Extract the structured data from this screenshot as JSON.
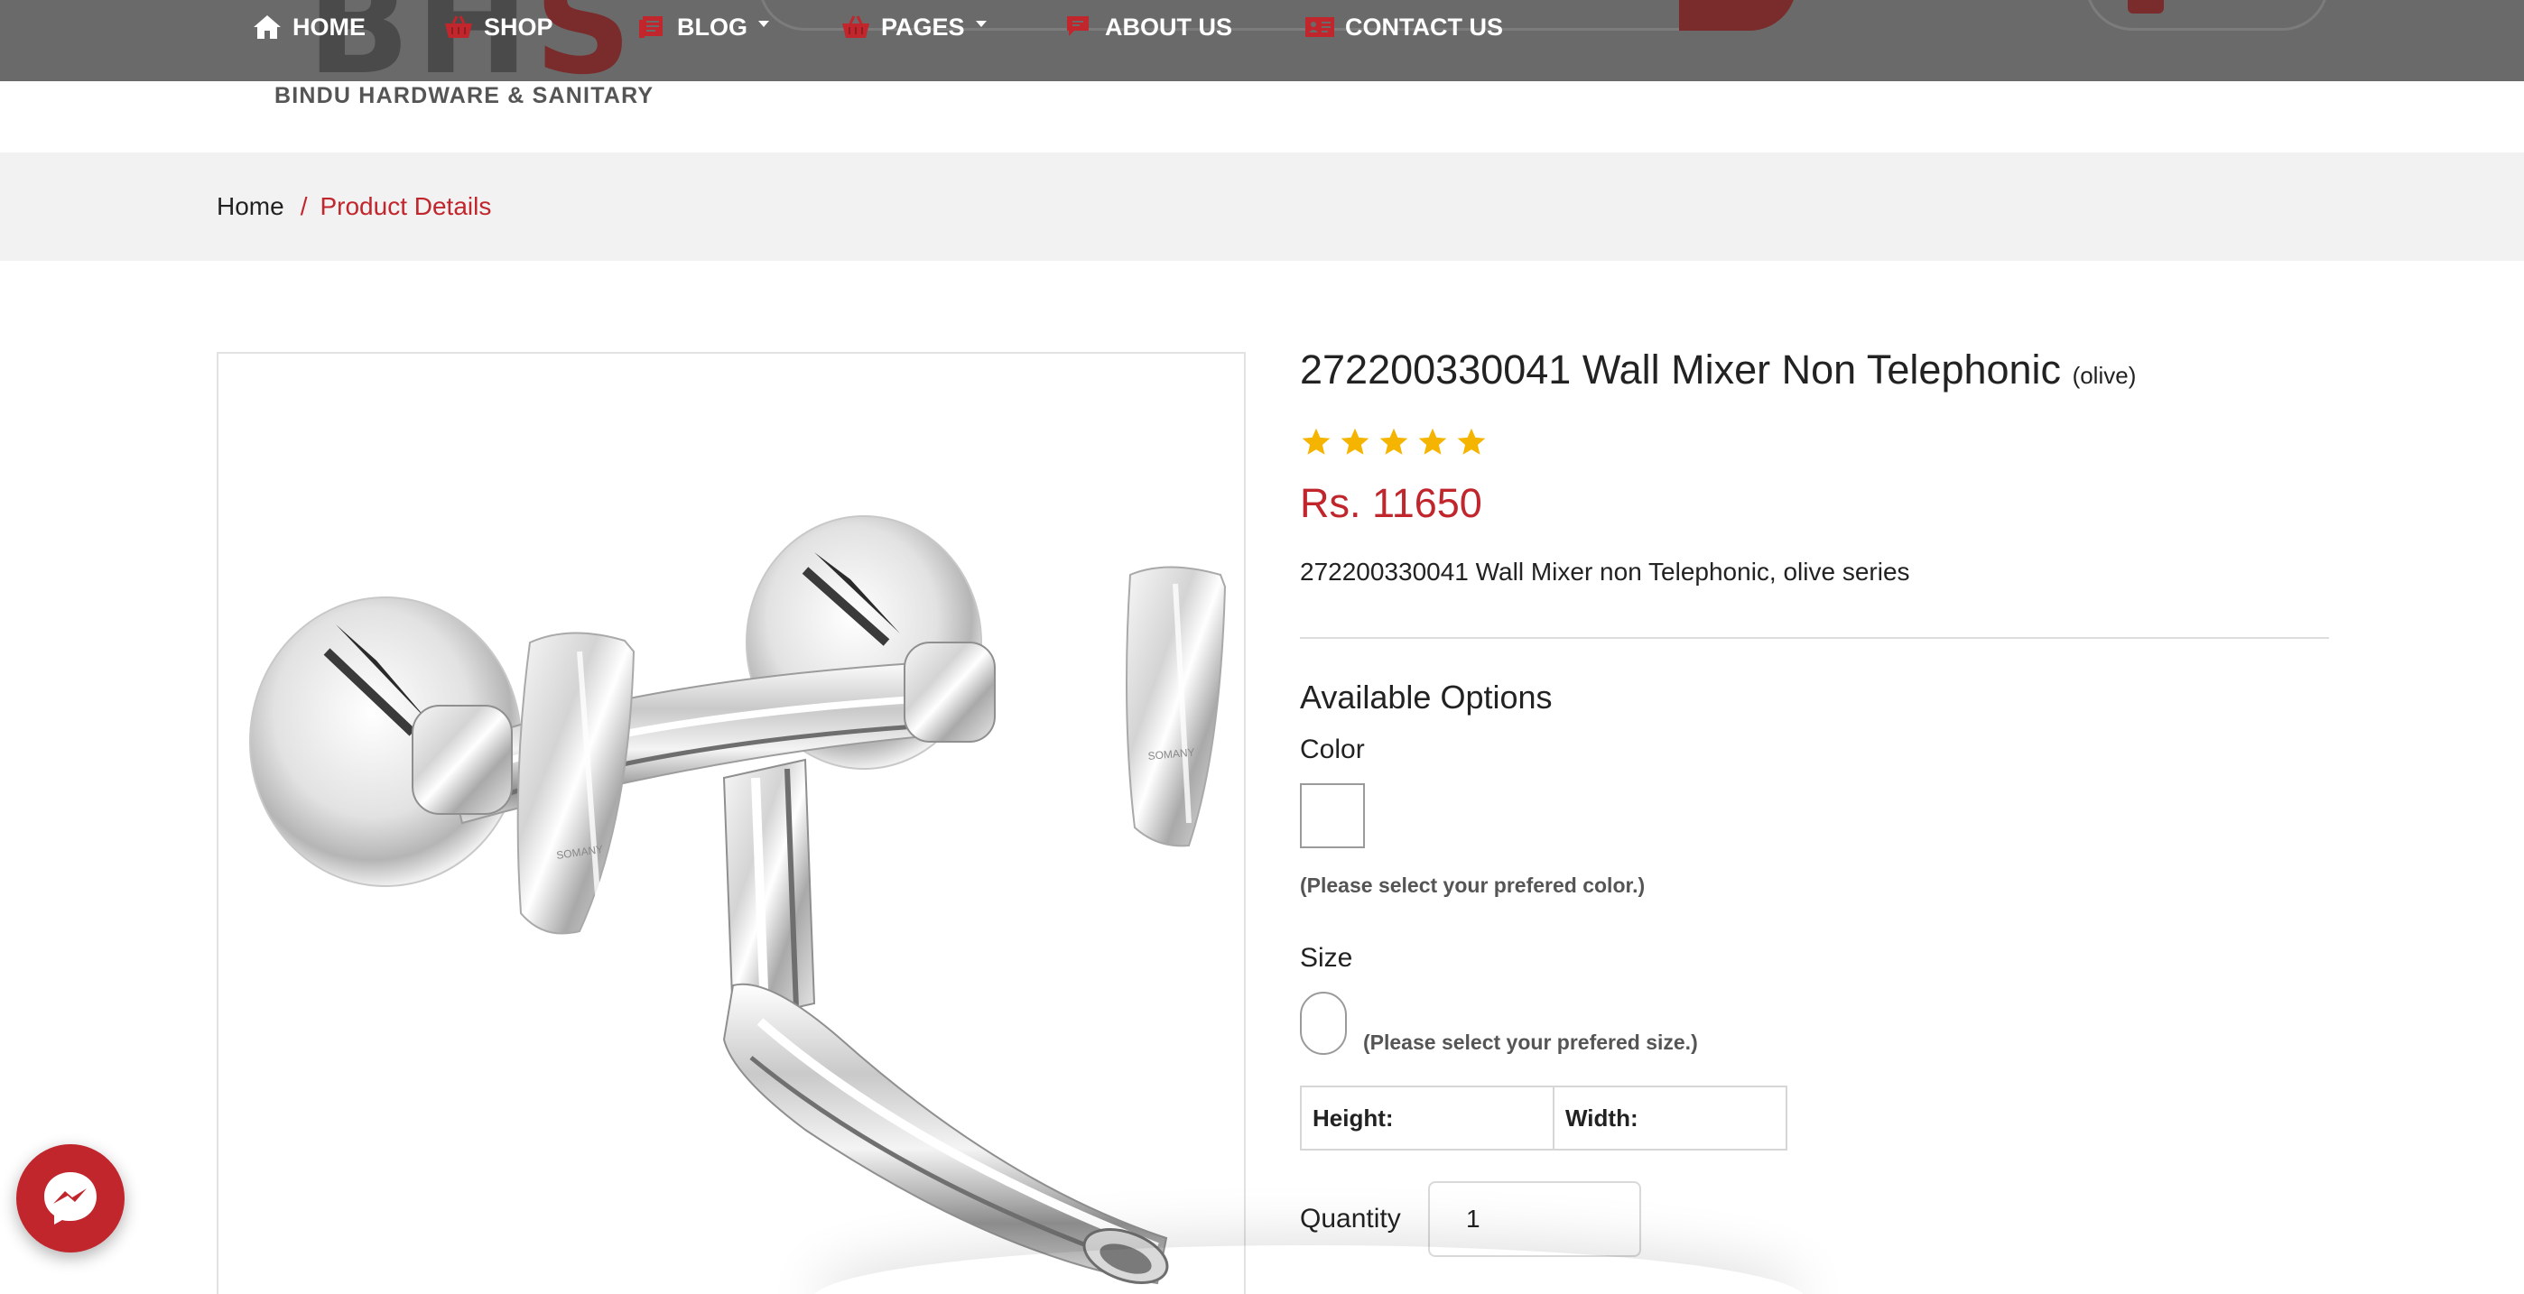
{
  "nav": {
    "items": [
      {
        "label": "HOME",
        "icon": "home-icon",
        "dropdown": false
      },
      {
        "label": "SHOP",
        "icon": "basket-icon",
        "dropdown": false
      },
      {
        "label": "BLOG",
        "icon": "blog-icon",
        "dropdown": true
      },
      {
        "label": "PAGES",
        "icon": "basket-icon",
        "dropdown": true
      },
      {
        "label": "ABOUT US",
        "icon": "chat-icon",
        "dropdown": false
      },
      {
        "label": "CONTACT US",
        "icon": "contact-card-icon",
        "dropdown": false
      }
    ]
  },
  "brand": {
    "logo_text": "BHS",
    "subtitle": "BINDU HARDWARE & SANITARY"
  },
  "breadcrumb": {
    "home": "Home",
    "separator": "/",
    "current": "Product Details"
  },
  "product": {
    "title": "272200330041 Wall Mixer Non Telephonic",
    "variant": "(olive)",
    "rating": 5,
    "rating_max": 5,
    "price": "Rs. 11650",
    "description": "272200330041 Wall Mixer non Telephonic, olive series"
  },
  "options": {
    "heading": "Available Options",
    "color_label": "Color",
    "color_hint": "(Please select your prefered color.)",
    "size_label": "Size",
    "size_hint": "(Please select your prefered size.)",
    "height_label": "Height:",
    "width_label": "Width:",
    "quantity_label": "Quantity",
    "quantity_value": "1"
  },
  "colors": {
    "accent": "#c0262c",
    "star": "#f4b400",
    "header_bg": "#6a6a6a",
    "breadcrumb_bg": "#f2f2f2"
  },
  "widgets": {
    "messenger_icon": "messenger-icon"
  }
}
